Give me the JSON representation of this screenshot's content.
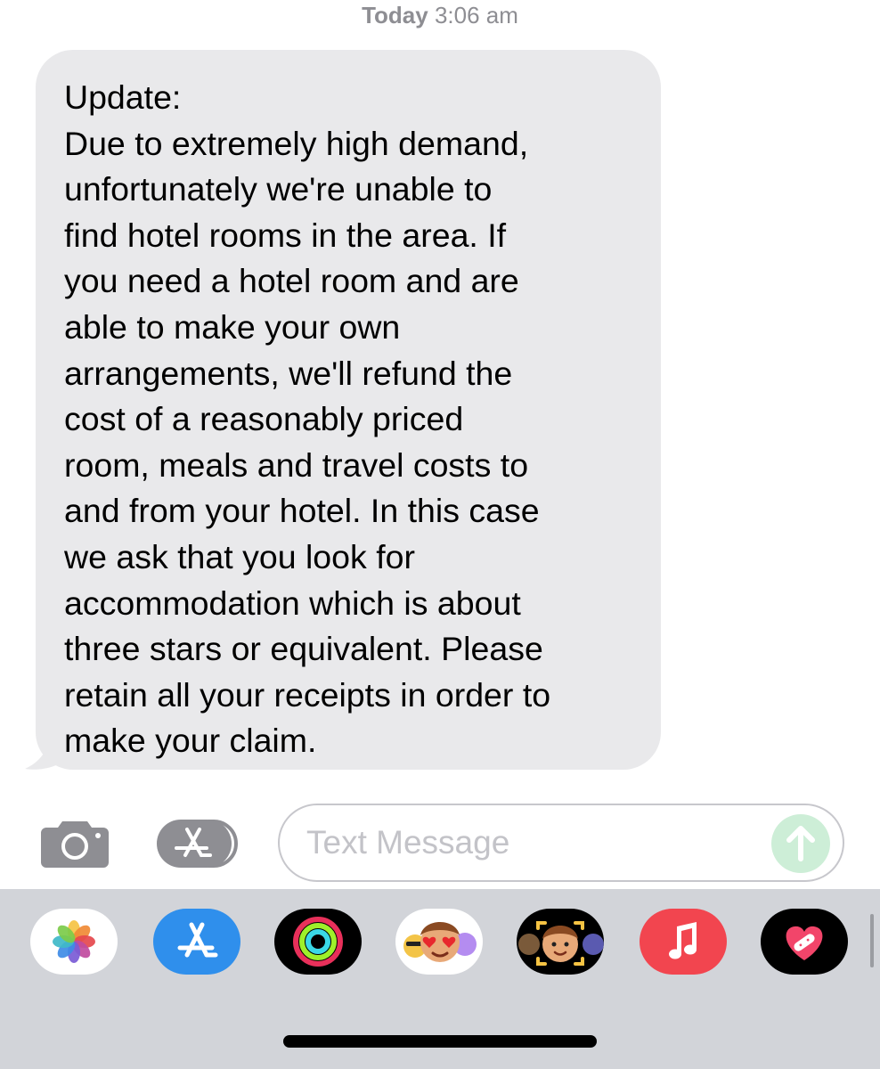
{
  "timestamp": {
    "day": "Today",
    "time": "3:06 am"
  },
  "message": {
    "lines": [
      "Update:",
      "Due to extremely high demand,",
      "unfortunately we're unable to",
      "find hotel rooms in the area. If",
      "you need a hotel room and are",
      "able to make your own",
      "arrangements, we'll refund the",
      "cost of a reasonably priced",
      "room, meals and travel costs to",
      "and from your hotel. In this case",
      "we ask that you look for",
      "accommodation which is about",
      "three stars or equivalent. Please",
      "retain all your receipts in order to",
      "make your claim."
    ],
    "bubble_color": "#e9e9eb"
  },
  "composer": {
    "placeholder": "Text Message",
    "value": "",
    "send_button_color": "#cdeed7",
    "camera_icon": "camera-icon",
    "apps_icon": "app-store-icon"
  },
  "app_drawer": {
    "background": "#d2d4d9",
    "apps": [
      {
        "name": "photos-app-icon"
      },
      {
        "name": "app-store-app-icon"
      },
      {
        "name": "activity-app-icon"
      },
      {
        "name": "memoji-stickers-app-icon"
      },
      {
        "name": "animoji-app-icon"
      },
      {
        "name": "music-app-icon"
      },
      {
        "name": "heart-app-icon"
      }
    ]
  }
}
